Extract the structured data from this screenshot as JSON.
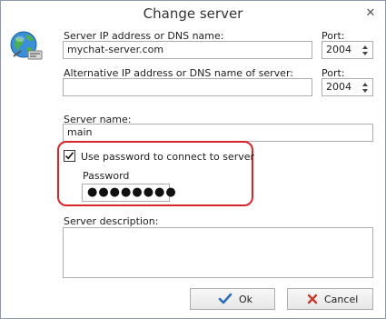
{
  "dialog": {
    "title": "Change server",
    "close_glyph": "✕"
  },
  "icons": {
    "server": "globe-network-icon",
    "close": "close-icon",
    "ok": "checkmark-icon",
    "cancel": "cross-icon"
  },
  "colors": {
    "highlight": "#d7262b",
    "ok_check": "#2b6fb6",
    "cancel_cross": "#c43b2f"
  },
  "form": {
    "server_address_label": "Server IP address or DNS name:",
    "server_address_value": "mychat-server.com",
    "port_label": "Port:",
    "port_value": "2004",
    "alt_address_label": "Alternative IP address or DNS name of server:",
    "alt_address_value": "",
    "alt_port_label": "Port:",
    "alt_port_value": "2004",
    "server_name_label": "Server name:",
    "server_name_value": "main",
    "use_password_label": "Use password to connect to server",
    "use_password_checked": true,
    "password_label": "Password",
    "password_mask": "●●●●●●●●",
    "description_label": "Server description:",
    "description_value": ""
  },
  "buttons": {
    "ok_label": "Ok",
    "cancel_label": "Cancel"
  }
}
